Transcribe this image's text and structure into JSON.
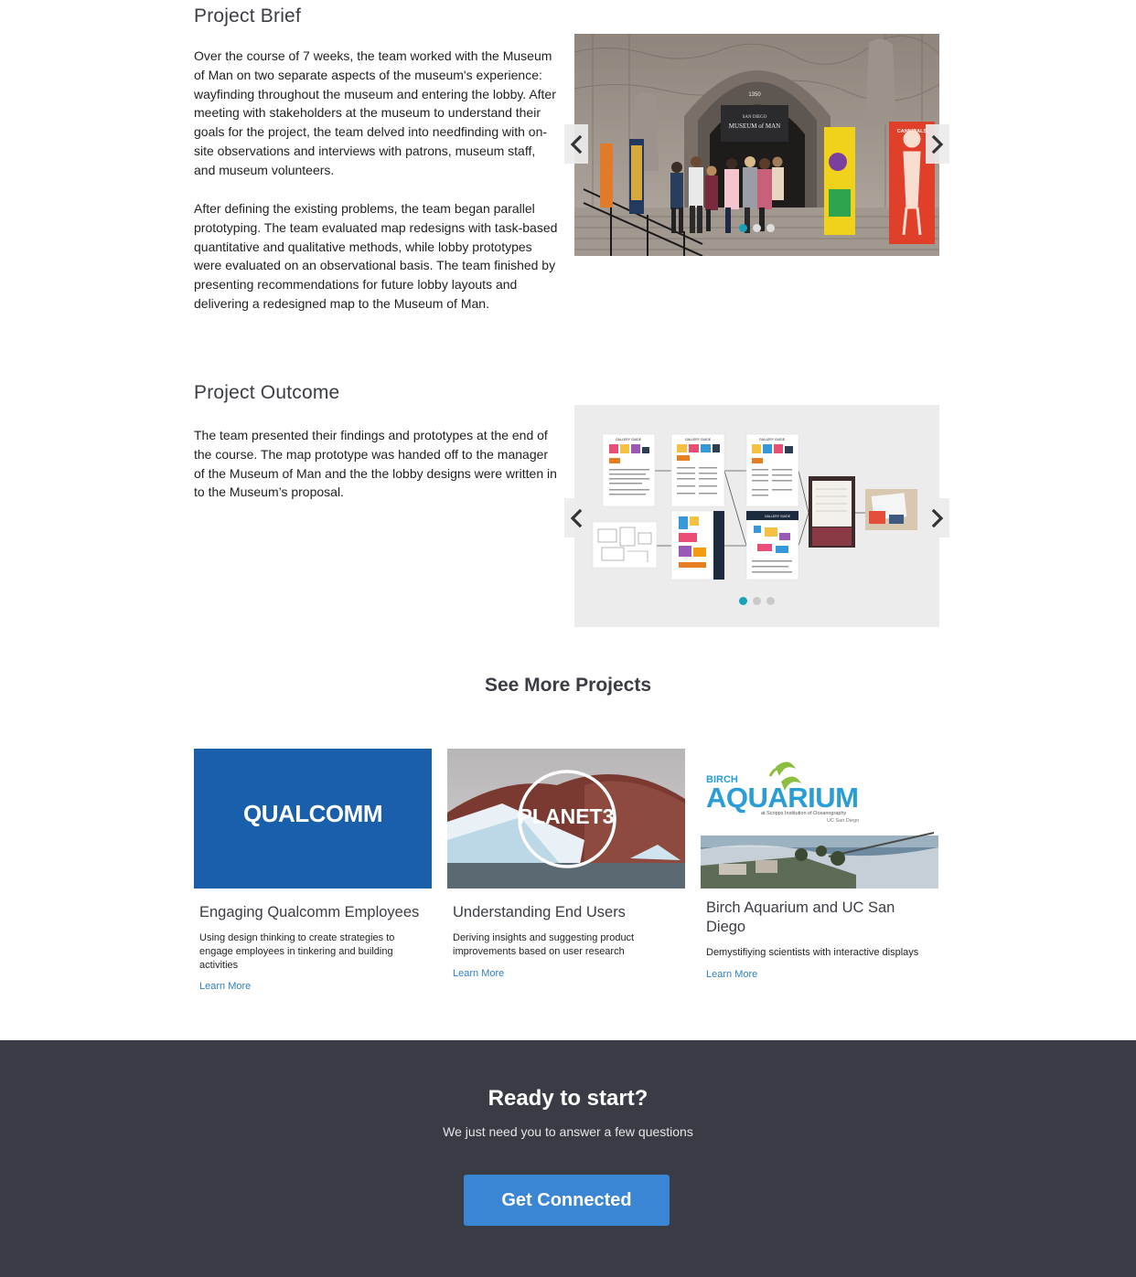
{
  "brief": {
    "title": "Project Brief",
    "paragraphs": [
      "Over the course of 7 weeks, the team worked with the Museum of Man on two separate aspects of the museum's experience: wayfinding throughout the museum and entering the lobby. After meeting with stakeholders at the museum to understand their goals for the project, the team delved into needfinding with on-site observations and interviews with patrons, museum staff, and museum volunteers.",
      "After defining the existing problems, the team began parallel prototyping. The team evaluated map redesigns with task-based quantitative and qualitative methods, while lobby prototypes were evaluated on an observational basis. The team finished by presenting recommendations for future lobby layouts and delivering a redesigned map to the Museum of Man."
    ],
    "carousel": {
      "photo_sign_line1": "SAN DIEGO",
      "photo_sign_line2": "MUSEUM of MAN",
      "photo_address": "1350",
      "banner_right": "CANNIBALS",
      "slide_count": 3,
      "active_slide": 1
    }
  },
  "outcome": {
    "title": "Project Outcome",
    "paragraph": "The team presented their findings and prototypes at the end of the course. The map prototype was handed off to the manager of the Museum of Man and the the lobby designs were written in to the Museum’s proposal.",
    "carousel": {
      "guide_label": "GALLERY GUIDE",
      "vertical_label": "GALLERY GUIDE",
      "slide_count": 3,
      "active_slide": 1
    }
  },
  "more": {
    "title": "See More Projects",
    "cards": [
      {
        "logo": "QUALCOMM",
        "title": "Engaging Qualcomm Employees",
        "desc": "Using design thinking to create strategies to engage employees in tinkering and building activities",
        "link": "Learn More"
      },
      {
        "logo": "PLANET3",
        "title": "Understanding End Users",
        "desc": "Deriving insights and suggesting product improvements based on user research",
        "link": "Learn More"
      },
      {
        "logo_small": "BIRCH",
        "logo": "AQUARIUM",
        "logo_sub": "at Scripps Institution of Oceanography",
        "logo_sub2": "UC San Diego",
        "title": "Birch Aquarium and UC San Diego",
        "desc": "Demystifiying scientists with interactive displays",
        "link": "Learn More"
      }
    ]
  },
  "footer": {
    "title": "Ready to start?",
    "subtitle": "We just need you to answer a few questions",
    "button": "Get Connected"
  },
  "colors": {
    "accent": "#3a86d4",
    "dot_active": "#17a2b8",
    "footer_bg": "#393c45",
    "link": "#2f7fc1"
  }
}
